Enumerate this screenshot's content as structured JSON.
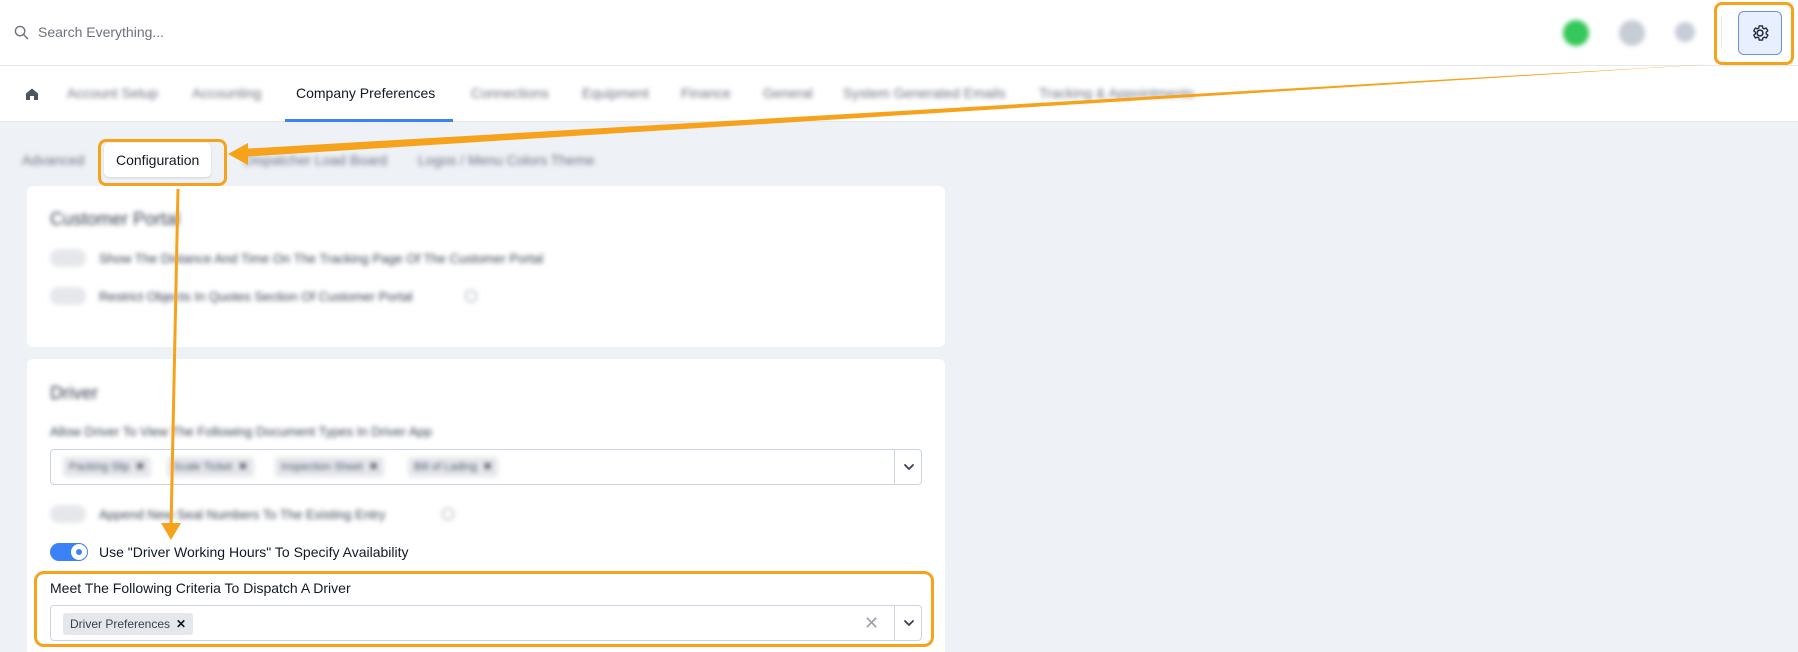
{
  "search": {
    "placeholder": "Search Everything...",
    "icon": "search-icon"
  },
  "topbar": {
    "icons": [
      "user-avatar-icon",
      "chat-icon",
      "bell-icon",
      "gear-icon"
    ]
  },
  "nav": {
    "home_icon": "home-icon",
    "tabs": [
      {
        "label": "Account Setup",
        "active": false
      },
      {
        "label": "Accounting",
        "active": false
      },
      {
        "label": "Company Preferences",
        "active": true
      },
      {
        "label": "Connections",
        "active": false
      },
      {
        "label": "Equipment",
        "active": false
      },
      {
        "label": "Finance",
        "active": false
      },
      {
        "label": "General",
        "active": false
      },
      {
        "label": "System Generated Emails",
        "active": false
      },
      {
        "label": "Tracking & Appointments",
        "active": false
      }
    ]
  },
  "subtabs": [
    {
      "label": "Advanced",
      "active": false
    },
    {
      "label": "Configuration",
      "active": true
    },
    {
      "label": "Dispatcher Load Board",
      "active": false
    },
    {
      "label": "Logos / Menu Colors Theme",
      "active": false
    }
  ],
  "customer_portal": {
    "title": "Customer Portal",
    "rows": [
      "Show The Distance And Time On The Tracking Page Of The Customer Portal",
      "Restrict Objects In Quotes Section Of Customer Portal"
    ]
  },
  "driver": {
    "title": "Driver",
    "doc_types_label": "Allow Driver To View The Following Document Types In Driver App",
    "doc_types": [
      "Packing Slip",
      "Scale Ticket",
      "Inspection Sheet",
      "Bill of Lading"
    ],
    "seal_row": "Append New Seal Numbers To The Existing Entry",
    "working_hours_label": "Use \"Driver Working Hours\" To Specify Availability",
    "working_hours_enabled": true,
    "criteria_label": "Meet The Following Criteria To Dispatch A Driver",
    "criteria_values": [
      "Driver Preferences"
    ]
  },
  "colors": {
    "accent": "#3b82f6",
    "callout": "#f7a21b",
    "active_tab_underline": "#3b82f6"
  }
}
